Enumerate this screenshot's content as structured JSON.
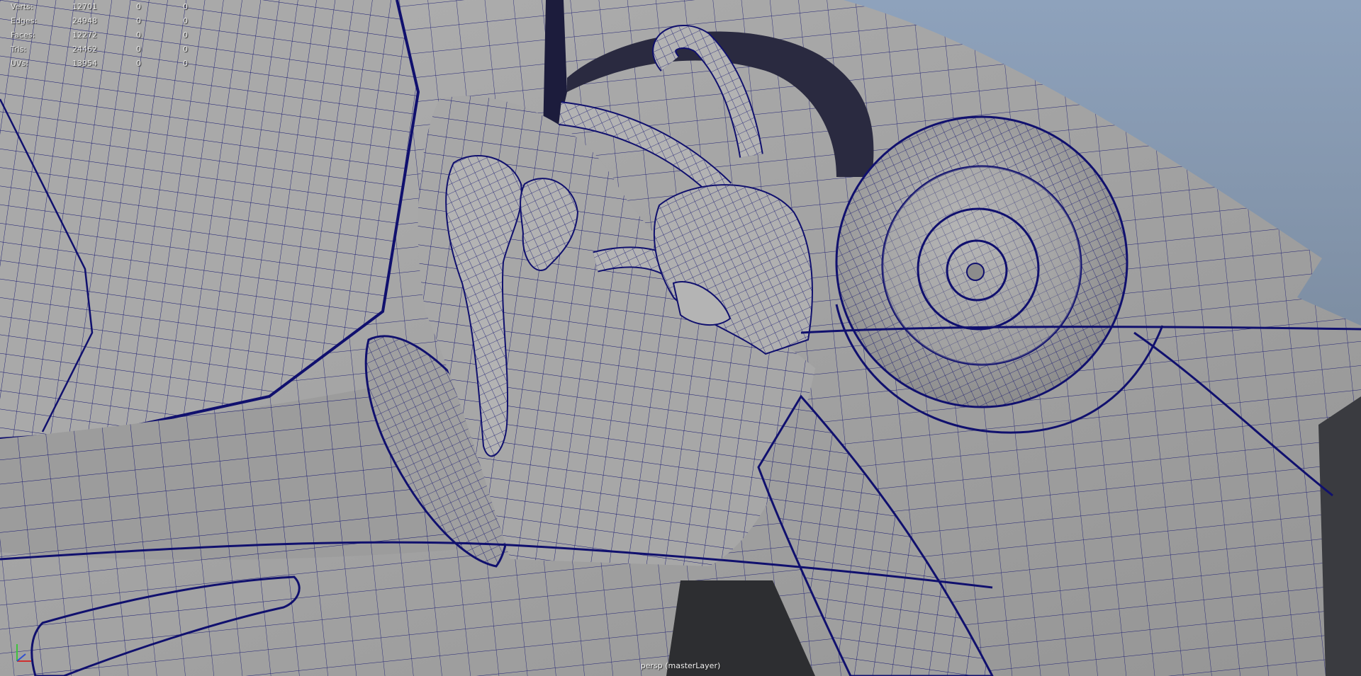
{
  "stats": [
    {
      "label": "Verts:",
      "v1": "12701",
      "v2": "0",
      "v3": "0"
    },
    {
      "label": "Edges:",
      "v1": "24948",
      "v2": "0",
      "v3": "0"
    },
    {
      "label": "Faces:",
      "v1": "12272",
      "v2": "0",
      "v3": "0"
    },
    {
      "label": "Tris:",
      "v1": "24462",
      "v2": "0",
      "v3": "0"
    },
    {
      "label": "UVs:",
      "v1": "13954",
      "v2": "0",
      "v3": "0"
    }
  ],
  "camera_label": "persp (masterLayer)",
  "colors": {
    "mesh_fill": "#a3a3a3",
    "wire": "#10106e",
    "background_top": "#8ea2bc",
    "background_bottom": "#6c7988",
    "cavity": "#2d2e31"
  }
}
